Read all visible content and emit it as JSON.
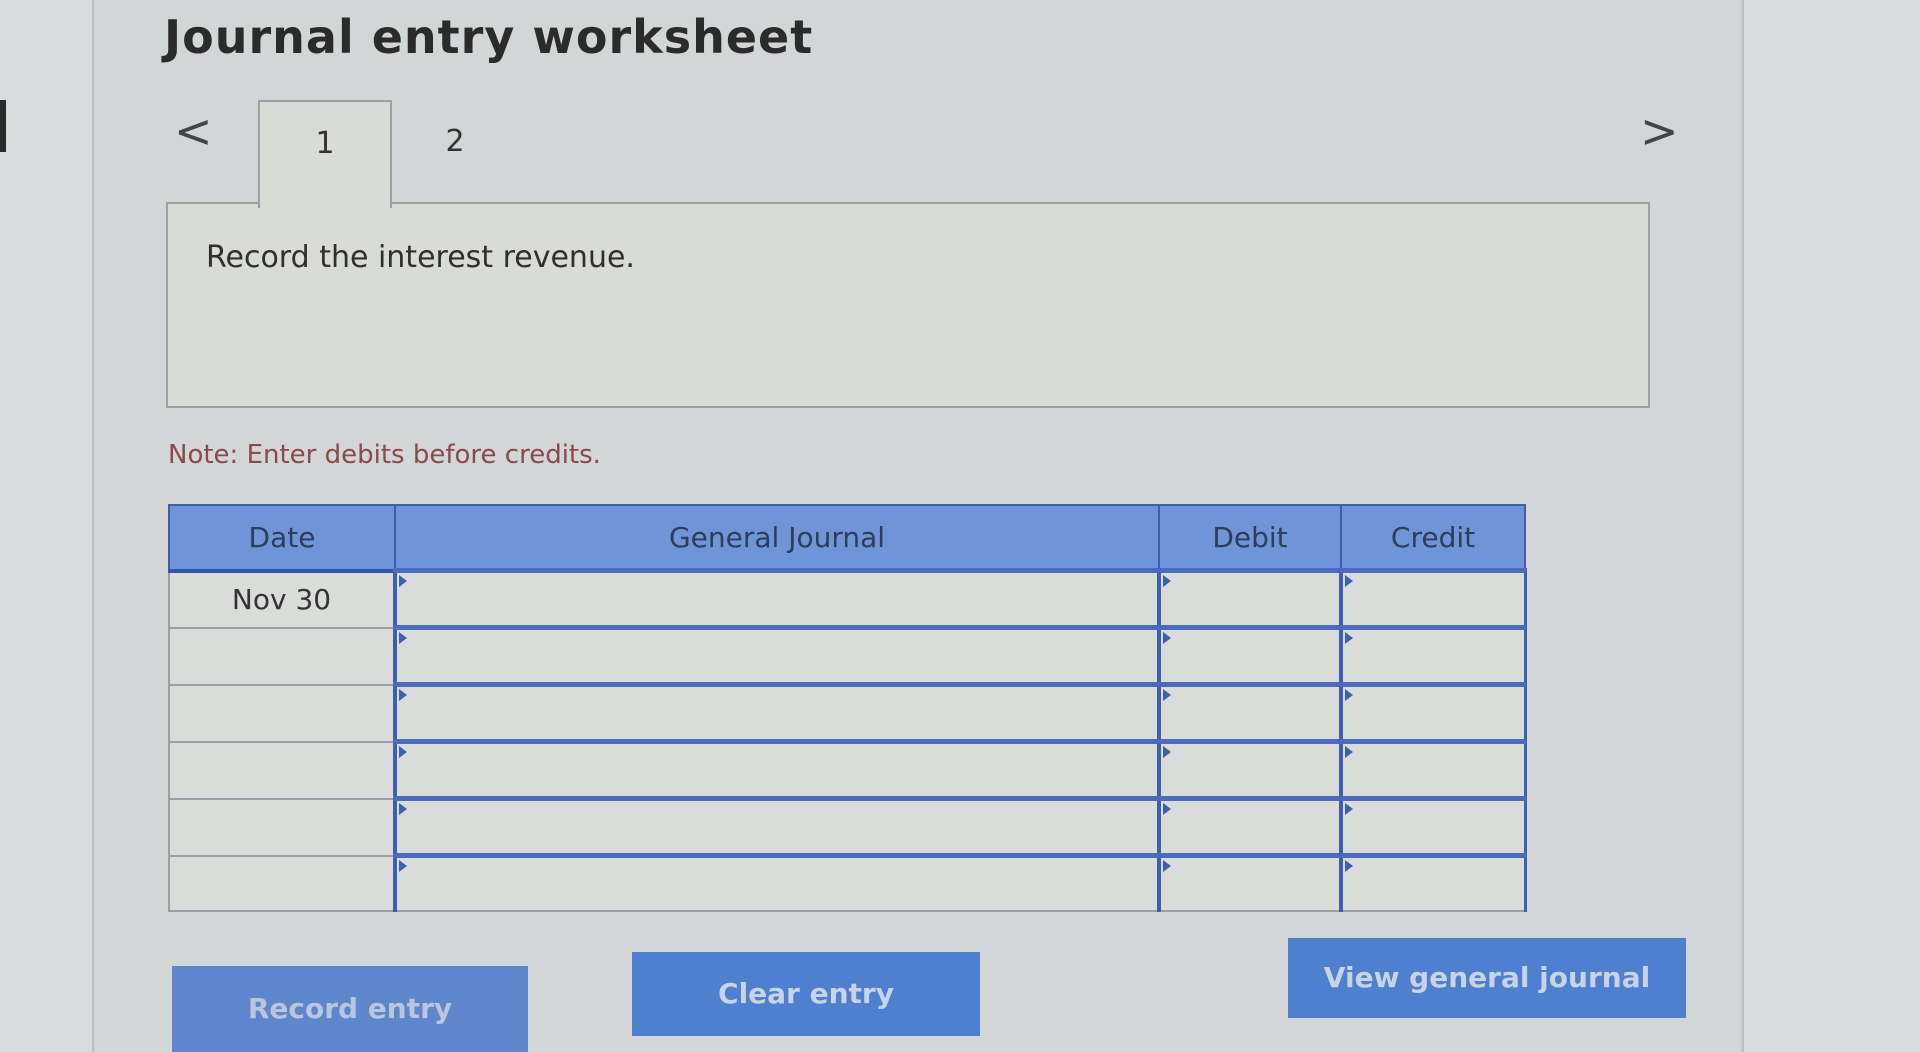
{
  "worksheet": {
    "title": "Journal entry worksheet",
    "tabs": [
      {
        "label": "1",
        "active": true
      },
      {
        "label": "2",
        "active": false
      }
    ],
    "nav": {
      "prev_icon": "chevron-left-icon",
      "next_icon": "chevron-right-icon",
      "prev_glyph": "<",
      "next_glyph": ">"
    },
    "instruction": "Record the interest revenue.",
    "note": "Note: Enter debits before credits."
  },
  "journal_table": {
    "headers": {
      "date": "Date",
      "general_journal": "General Journal",
      "debit": "Debit",
      "credit": "Credit"
    },
    "rows": [
      {
        "date": "Nov 30",
        "account": "",
        "debit": "",
        "credit": ""
      },
      {
        "date": "",
        "account": "",
        "debit": "",
        "credit": ""
      },
      {
        "date": "",
        "account": "",
        "debit": "",
        "credit": ""
      },
      {
        "date": "",
        "account": "",
        "debit": "",
        "credit": ""
      },
      {
        "date": "",
        "account": "",
        "debit": "",
        "credit": ""
      },
      {
        "date": "",
        "account": "",
        "debit": "",
        "credit": ""
      }
    ]
  },
  "buttons": {
    "record_entry": "Record entry",
    "clear_entry": "Clear entry",
    "view_general_journal": "View general journal"
  },
  "colors": {
    "header_blue": "#6f95d8",
    "button_blue": "#4f7fcf",
    "note_red": "#8a4a4a"
  }
}
